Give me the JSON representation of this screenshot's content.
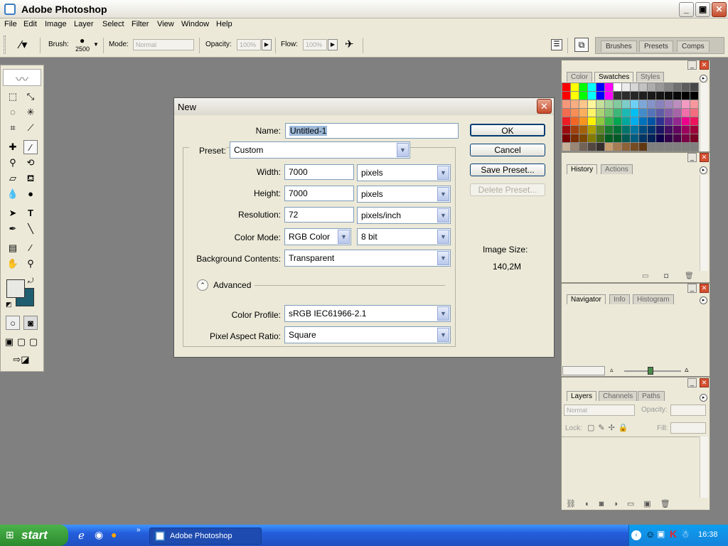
{
  "window": {
    "title": "Adobe Photoshop",
    "minimize": "_",
    "restore": "▣",
    "close": "✕"
  },
  "menu": [
    "File",
    "Edit",
    "Image",
    "Layer",
    "Select",
    "Filter",
    "View",
    "Window",
    "Help"
  ],
  "options": {
    "brush_label": "Brush:",
    "brush_size": "2500",
    "mode_label": "Mode:",
    "mode_value": "Normal",
    "opacity_label": "Opacity:",
    "opacity_value": "100%",
    "flow_label": "Flow:",
    "flow_value": "100%"
  },
  "palette_well": {
    "tabs": [
      "Brushes",
      "Presets",
      "Comps"
    ]
  },
  "dialog": {
    "title": "New",
    "name_label": "Name:",
    "name_value": "Untitled-1",
    "preset_label": "Preset:",
    "preset_value": "Custom",
    "width_label": "Width:",
    "width_value": "7000",
    "width_unit": "pixels",
    "height_label": "Height:",
    "height_value": "7000",
    "height_unit": "pixels",
    "resolution_label": "Resolution:",
    "resolution_value": "72",
    "resolution_unit": "pixels/inch",
    "color_mode_label": "Color Mode:",
    "color_mode_value": "RGB Color",
    "bit_depth_value": "8 bit",
    "background_label": "Background Contents:",
    "background_value": "Transparent",
    "advanced_label": "Advanced",
    "color_profile_label": "Color Profile:",
    "color_profile_value": "sRGB IEC61966-2.1",
    "pixel_aspect_label": "Pixel Aspect Ratio:",
    "pixel_aspect_value": "Square",
    "ok": "OK",
    "cancel": "Cancel",
    "save_preset": "Save Preset...",
    "delete_preset": "Delete Preset...",
    "image_size_label": "Image Size:",
    "image_size_value": "140,2M"
  },
  "panels": {
    "color_tabs": [
      "Color",
      "Swatches",
      "Styles"
    ],
    "history_tabs": [
      "History",
      "Actions"
    ],
    "navigator_tabs": [
      "Navigator",
      "Info",
      "Histogram"
    ],
    "layers_tabs": [
      "Layers",
      "Channels",
      "Paths"
    ],
    "layers_blend": "Normal",
    "layers_opacity_label": "Opacity:",
    "layers_lock_label": "Lock:",
    "layers_fill_label": "Fill:"
  },
  "taskbar": {
    "start": "start",
    "task_item": "Adobe Photoshop",
    "clock": "16:38"
  },
  "colors": {
    "foreground": "#e8e8e4",
    "background": "#1f5e70",
    "xp_blue": "#245edc"
  }
}
